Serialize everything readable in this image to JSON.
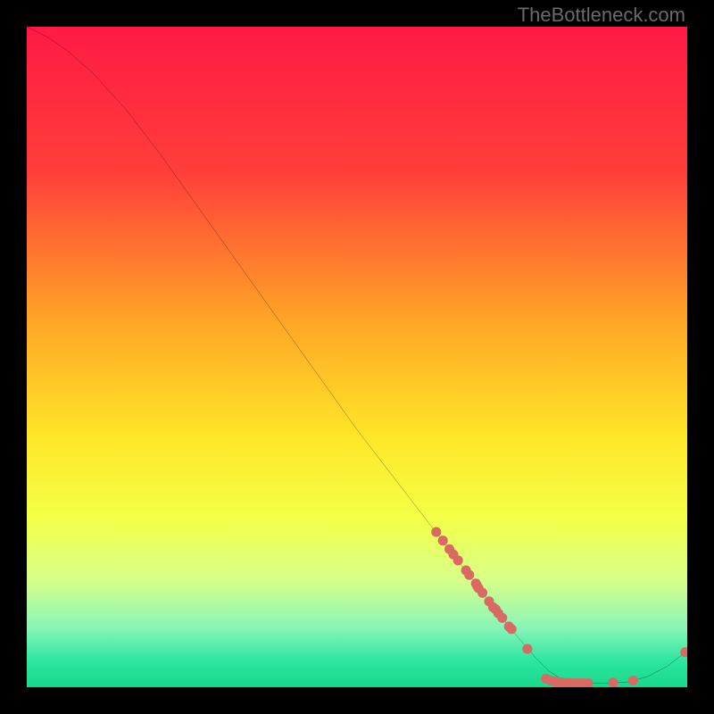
{
  "watermark": "TheBottleneck.com",
  "chart_data": {
    "type": "line",
    "title": "",
    "xlabel": "",
    "ylabel": "",
    "xlim": [
      0,
      100
    ],
    "ylim": [
      0,
      100
    ],
    "background_gradient": {
      "stops": [
        {
          "pos": 0,
          "color": "#ff1a44"
        },
        {
          "pos": 22,
          "color": "#ff3e3a"
        },
        {
          "pos": 45,
          "color": "#ffa726"
        },
        {
          "pos": 62,
          "color": "#ffe628"
        },
        {
          "pos": 74,
          "color": "#f4ff45"
        },
        {
          "pos": 84,
          "color": "#d6ff8a"
        },
        {
          "pos": 91,
          "color": "#88f5b8"
        },
        {
          "pos": 96,
          "color": "#2de6a0"
        },
        {
          "pos": 100,
          "color": "#17d98b"
        }
      ]
    },
    "curve": [
      {
        "x": 0,
        "y": 100
      },
      {
        "x": 3,
        "y": 98.5
      },
      {
        "x": 6,
        "y": 96.5
      },
      {
        "x": 10,
        "y": 93
      },
      {
        "x": 15,
        "y": 87.5
      },
      {
        "x": 20,
        "y": 81
      },
      {
        "x": 30,
        "y": 67
      },
      {
        "x": 40,
        "y": 53
      },
      {
        "x": 50,
        "y": 39
      },
      {
        "x": 60,
        "y": 26
      },
      {
        "x": 65,
        "y": 19.5
      },
      {
        "x": 70,
        "y": 13
      },
      {
        "x": 74,
        "y": 8
      },
      {
        "x": 77,
        "y": 4.5
      },
      {
        "x": 79,
        "y": 2.5
      },
      {
        "x": 81,
        "y": 1.2
      },
      {
        "x": 84,
        "y": 0.6
      },
      {
        "x": 88,
        "y": 0.6
      },
      {
        "x": 91,
        "y": 0.8
      },
      {
        "x": 94,
        "y": 1.6
      },
      {
        "x": 97,
        "y": 3.2
      },
      {
        "x": 100,
        "y": 5.5
      }
    ],
    "markers": [
      {
        "x": 62,
        "y": 23.5
      },
      {
        "x": 63,
        "y": 22.2
      },
      {
        "x": 64,
        "y": 20.9
      },
      {
        "x": 64.6,
        "y": 20.1
      },
      {
        "x": 65.3,
        "y": 19.2
      },
      {
        "x": 66.5,
        "y": 17.7
      },
      {
        "x": 67,
        "y": 17.0
      },
      {
        "x": 68,
        "y": 15.7
      },
      {
        "x": 68.2,
        "y": 15.3
      },
      {
        "x": 68.4,
        "y": 15.0
      },
      {
        "x": 69,
        "y": 14.3
      },
      {
        "x": 70,
        "y": 13.0
      },
      {
        "x": 70.6,
        "y": 12.1
      },
      {
        "x": 71,
        "y": 11.8
      },
      {
        "x": 71.4,
        "y": 11.2
      },
      {
        "x": 72,
        "y": 10.5
      },
      {
        "x": 73,
        "y": 9.2
      },
      {
        "x": 73.4,
        "y": 8.8
      },
      {
        "x": 75.8,
        "y": 5.8
      },
      {
        "x": 78.6,
        "y": 1.3
      },
      {
        "x": 79.3,
        "y": 1.0
      },
      {
        "x": 80,
        "y": 0.85
      },
      {
        "x": 80.5,
        "y": 0.8
      },
      {
        "x": 81.2,
        "y": 0.7
      },
      {
        "x": 82,
        "y": 0.65
      },
      {
        "x": 82.4,
        "y": 0.6
      },
      {
        "x": 83,
        "y": 0.6
      },
      {
        "x": 83.4,
        "y": 0.6
      },
      {
        "x": 84,
        "y": 0.6
      },
      {
        "x": 84.4,
        "y": 0.6
      },
      {
        "x": 85,
        "y": 0.6
      },
      {
        "x": 88.8,
        "y": 0.7
      },
      {
        "x": 91.8,
        "y": 1.0
      },
      {
        "x": 99.7,
        "y": 5.3
      }
    ],
    "marker_color": "#d96a63",
    "curve_color": "#000000"
  }
}
